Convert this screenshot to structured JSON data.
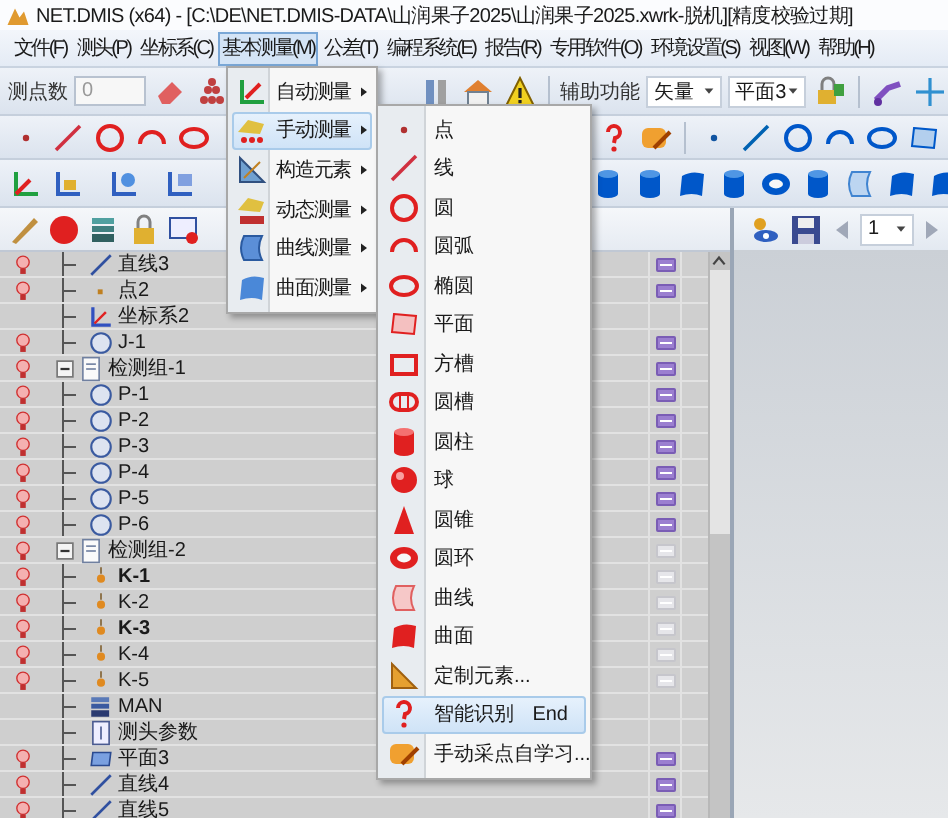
{
  "window": {
    "title": "NET.DMIS (x64) - [C:\\DE\\NET.DMIS-DATA\\山润果子2025\\山润果子2025.xwrk-脱机][精度校验过期]"
  },
  "menu_bar": [
    {
      "label": "文件(F)",
      "selected": false
    },
    {
      "label": "测头(P)",
      "selected": false
    },
    {
      "label": "坐标系(C)",
      "selected": false
    },
    {
      "label": "基本测量(M)",
      "selected": true
    },
    {
      "label": "公差(T)",
      "selected": false
    },
    {
      "label": "编程系统(E)",
      "selected": false
    },
    {
      "label": "报告(R)",
      "selected": false
    },
    {
      "label": "专用软件(O)",
      "selected": false
    },
    {
      "label": "环境设置(S)",
      "selected": false
    },
    {
      "label": "视图(W)",
      "selected": false
    },
    {
      "label": "帮助(H)",
      "selected": false
    }
  ],
  "toolbar": {
    "point_count_label": "测点数",
    "point_count": "0",
    "assist_label": "辅助功能",
    "assist_mode": "矢量",
    "plane": "平面3"
  },
  "measure_menu": [
    {
      "label": "自动测量",
      "kind": "auto",
      "selected": false,
      "has_submenu": true
    },
    {
      "label": "手动测量",
      "kind": "manual",
      "selected": true,
      "has_submenu": true
    },
    {
      "label": "构造元素",
      "kind": "construct",
      "selected": false,
      "has_submenu": true
    },
    {
      "label": "动态测量",
      "kind": "dynamic",
      "selected": false,
      "has_submenu": true
    },
    {
      "label": "曲线测量",
      "kind": "curve",
      "selected": false,
      "has_submenu": true
    },
    {
      "label": "曲面测量",
      "kind": "surface",
      "selected": false,
      "has_submenu": true
    }
  ],
  "manual_submenu": [
    {
      "label": "点",
      "kind": "point",
      "selected": false
    },
    {
      "label": "线",
      "kind": "line",
      "selected": false
    },
    {
      "label": "圆",
      "kind": "circle",
      "selected": false
    },
    {
      "label": "圆弧",
      "kind": "arc",
      "selected": false
    },
    {
      "label": "椭圆",
      "kind": "ellipse",
      "selected": false
    },
    {
      "label": "平面",
      "kind": "plane",
      "selected": false
    },
    {
      "label": "方槽",
      "kind": "slot_rect",
      "selected": false
    },
    {
      "label": "圆槽",
      "kind": "slot_round",
      "selected": false
    },
    {
      "label": "圆柱",
      "kind": "cylinder",
      "selected": false
    },
    {
      "label": "球",
      "kind": "sphere",
      "selected": false
    },
    {
      "label": "圆锥",
      "kind": "cone",
      "selected": false
    },
    {
      "label": "圆环",
      "kind": "torus",
      "selected": false
    },
    {
      "label": "曲线",
      "kind": "curve",
      "selected": false
    },
    {
      "label": "曲面",
      "kind": "surface",
      "selected": false
    },
    {
      "label": "定制元素...",
      "kind": "custom",
      "selected": false
    },
    {
      "label": "智能识别",
      "shortcut": "End",
      "kind": "smart",
      "selected": true
    },
    {
      "label": "手动采点自学习...",
      "kind": "teach",
      "selected": false
    }
  ],
  "page_selector": {
    "value": "1"
  },
  "tree": {
    "continued_items": [
      {
        "label": "直线3",
        "kind": "line",
        "visible": true,
        "has_report": true,
        "report_enabled": true,
        "emphasized": false
      },
      {
        "label": "点2",
        "kind": "point",
        "visible": true,
        "has_report": true,
        "report_enabled": true,
        "emphasized": false
      },
      {
        "label": "坐标系2",
        "kind": "coordinate_system",
        "visible": false,
        "has_report": false,
        "emphasized": false
      },
      {
        "label": "J-1",
        "kind": "circle",
        "visible": true,
        "has_report": true,
        "report_enabled": true,
        "emphasized": false
      }
    ],
    "groups": [
      {
        "label": "检测组-1",
        "expanded": true,
        "visible": true,
        "has_report": true,
        "report_enabled": true,
        "children": [
          {
            "label": "P-1",
            "kind": "circle",
            "visible": true,
            "has_report": true,
            "report_enabled": true,
            "emphasized": false
          },
          {
            "label": "P-2",
            "kind": "circle",
            "visible": true,
            "has_report": true,
            "report_enabled": true,
            "emphasized": false
          },
          {
            "label": "P-3",
            "kind": "circle",
            "visible": true,
            "has_report": true,
            "report_enabled": true,
            "emphasized": false
          },
          {
            "label": "P-4",
            "kind": "circle",
            "visible": true,
            "has_report": true,
            "report_enabled": true,
            "emphasized": false
          },
          {
            "label": "P-5",
            "kind": "circle",
            "visible": true,
            "has_report": true,
            "report_enabled": true,
            "emphasized": false
          },
          {
            "label": "P-6",
            "kind": "circle",
            "visible": true,
            "has_report": true,
            "report_enabled": true,
            "emphasized": false
          }
        ]
      },
      {
        "label": "检测组-2",
        "expanded": true,
        "visible": true,
        "has_report": true,
        "report_enabled": false,
        "children": [
          {
            "label": "K-1",
            "kind": "probe_point",
            "visible": true,
            "has_report": true,
            "report_enabled": false,
            "emphasized": true
          },
          {
            "label": "K-2",
            "kind": "probe_point",
            "visible": true,
            "has_report": true,
            "report_enabled": false,
            "emphasized": false
          },
          {
            "label": "K-3",
            "kind": "probe_point",
            "visible": true,
            "has_report": true,
            "report_enabled": false,
            "emphasized": true
          },
          {
            "label": "K-4",
            "kind": "probe_point",
            "visible": true,
            "has_report": true,
            "report_enabled": false,
            "emphasized": false
          },
          {
            "label": "K-5",
            "kind": "probe_point",
            "visible": true,
            "has_report": true,
            "report_enabled": false,
            "emphasized": false
          },
          {
            "label": "MAN",
            "kind": "man",
            "visible": false,
            "has_report": false,
            "emphasized": false
          },
          {
            "label": "测头参数",
            "kind": "probe_params",
            "visible": false,
            "has_report": false,
            "emphasized": false
          },
          {
            "label": "平面3",
            "kind": "plane",
            "visible": true,
            "has_report": true,
            "report_enabled": true,
            "emphasized": false
          },
          {
            "label": "直线4",
            "kind": "line",
            "visible": true,
            "has_report": true,
            "report_enabled": true,
            "emphasized": false
          },
          {
            "label": "直线5",
            "kind": "line",
            "visible": true,
            "has_report": true,
            "report_enabled": true,
            "emphasized": false
          }
        ]
      }
    ]
  }
}
